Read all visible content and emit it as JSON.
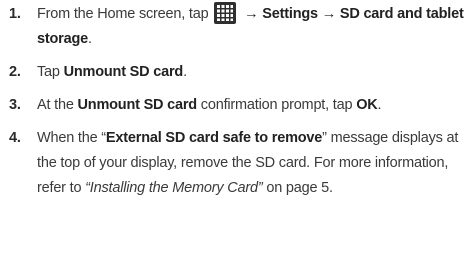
{
  "steps": [
    {
      "number": "1.",
      "part1": "From the Home screen, tap ",
      "icon": "apps-grid-icon",
      "arrow1": " → ",
      "settings": "Settings",
      "arrow2": " → ",
      "sd_storage": "SD card and tablet storage",
      "end": "."
    },
    {
      "number": "2.",
      "part1": "Tap ",
      "unmount": "Unmount SD card",
      "end": "."
    },
    {
      "number": "3.",
      "part1": "At the ",
      "prompt": "Unmount SD card",
      "part2": " confirmation prompt, tap ",
      "ok": "OK",
      "end": "."
    },
    {
      "number": "4.",
      "part1": "When the “",
      "message": "External SD card safe to remove",
      "part2": "” message displays at the top of your display, remove the SD card. For more information, refer to ",
      "ref": "“Installing the Memory Card”",
      "part3": " on page 5."
    }
  ]
}
